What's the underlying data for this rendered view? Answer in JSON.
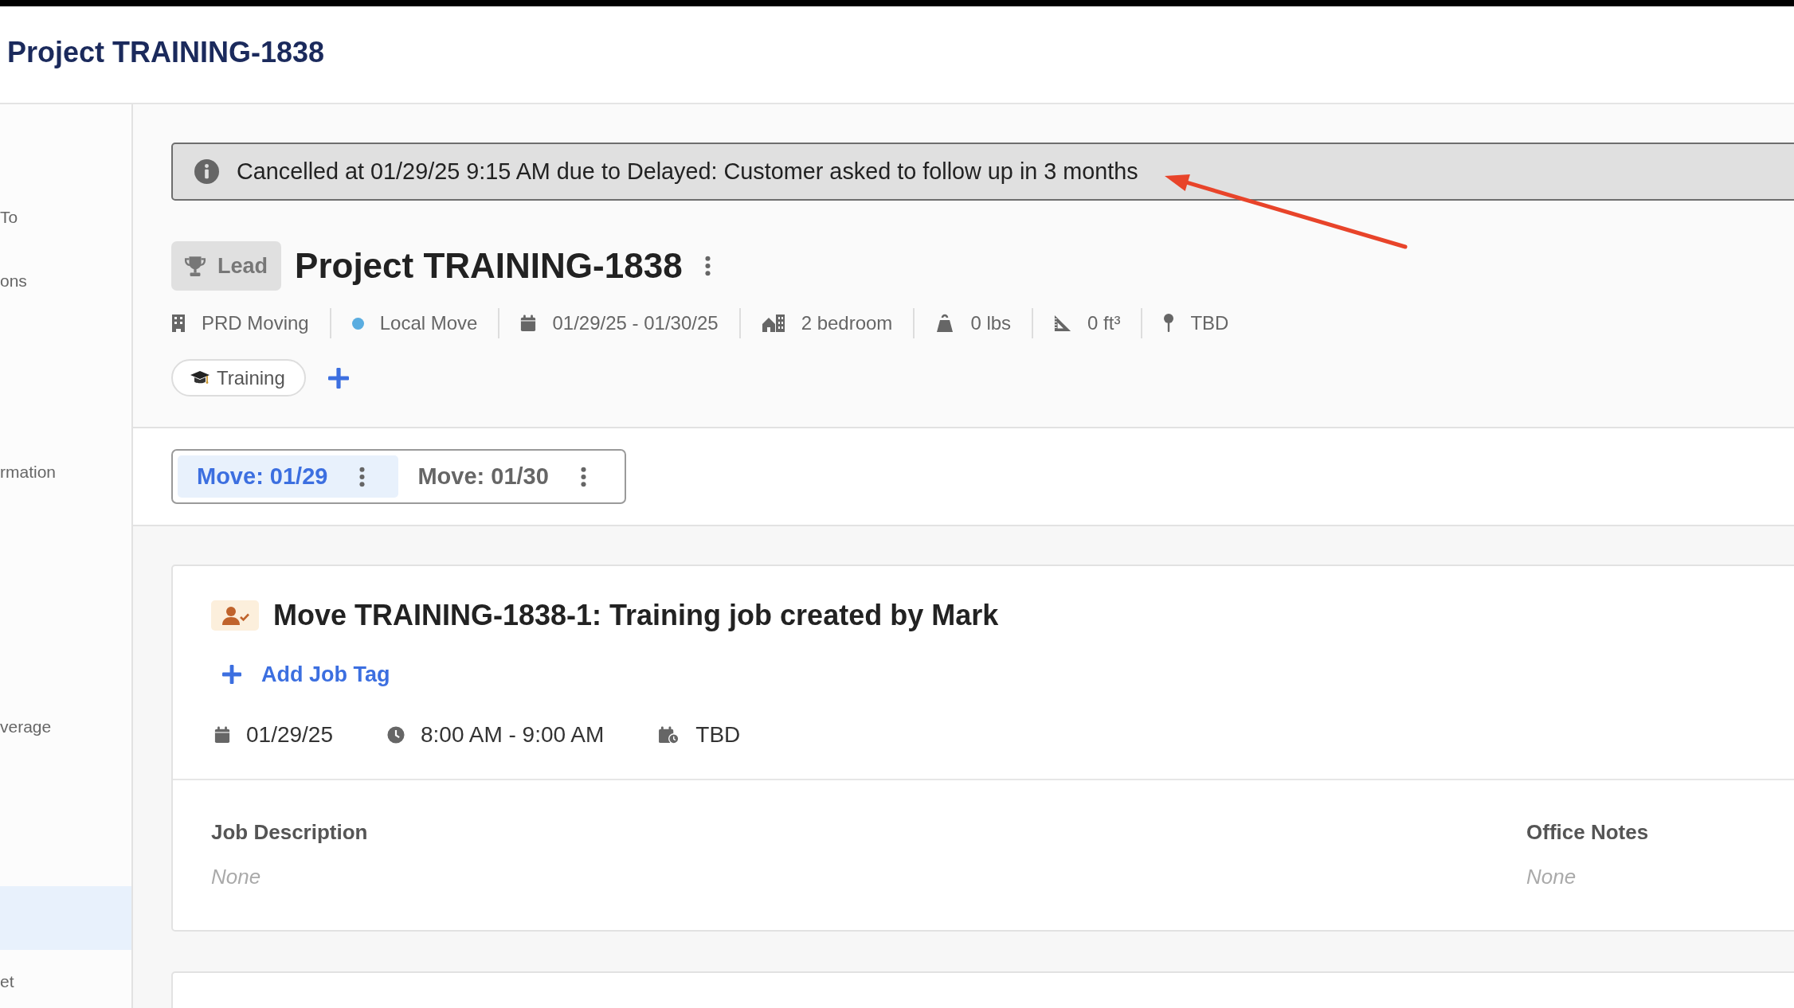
{
  "header": {
    "title": "Project TRAINING-1838"
  },
  "sidebar": {
    "items": [
      {
        "label": "To",
        "selected": false
      },
      {
        "label": "ons",
        "selected": false
      },
      {
        "label": "rmation",
        "selected": false
      },
      {
        "label": "verage",
        "selected": false
      },
      {
        "selected": true
      },
      {
        "label": "et",
        "selected": false
      }
    ]
  },
  "notice": {
    "text": "Cancelled at 01/29/25 9:15 AM due to Delayed: Customer asked to follow up in 3 months"
  },
  "project": {
    "status": "Lead",
    "title": "Project TRAINING-1838",
    "details": {
      "company": "PRD Moving",
      "move_type": {
        "label": "Local Move",
        "color": "#5aade0"
      },
      "dates": "01/29/25 - 01/30/25",
      "size": "2 bedroom",
      "weight": "0 lbs",
      "volume": "0 ft³",
      "location": "TBD"
    },
    "tags": [
      {
        "label": "Training"
      }
    ]
  },
  "move_tabs": [
    {
      "label": "Move: 01/29",
      "selected": true
    },
    {
      "label": "Move: 01/30",
      "selected": false
    }
  ],
  "job": {
    "title": "Move TRAINING-1838-1: Training job created by Mark",
    "add_tag_label": "Add Job Tag",
    "date": "01/29/25",
    "time": "8:00 AM - 9:00 AM",
    "arrival": "TBD",
    "sections": [
      {
        "heading": "Job Description",
        "value": "None"
      },
      {
        "heading": "Office Notes",
        "value": "None"
      }
    ]
  }
}
